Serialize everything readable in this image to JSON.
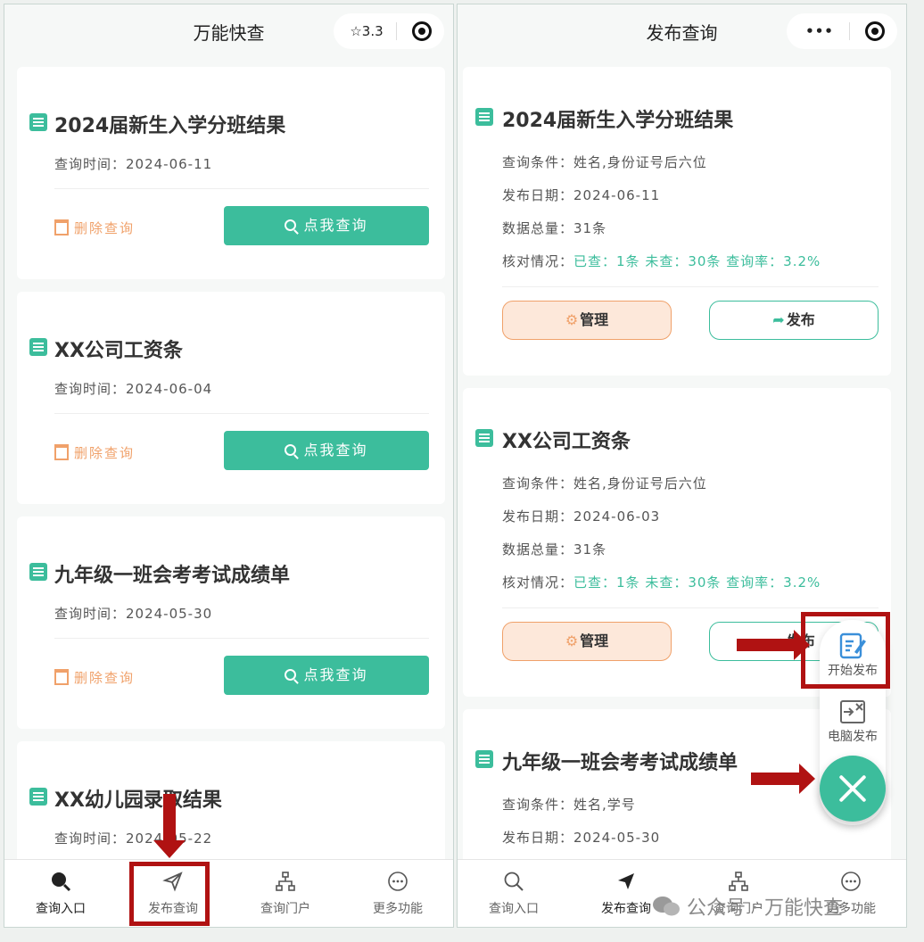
{
  "left": {
    "title": "万能快查",
    "rating": "☆3.3",
    "cards": [
      {
        "title": "2024届新生入学分班结果",
        "time": "查询时间：2024-06-11",
        "delete": "删除查询",
        "query": "点我查询"
      },
      {
        "title": "XX公司工资条",
        "time": "查询时间：2024-06-04",
        "delete": "删除查询",
        "query": "点我查询"
      },
      {
        "title": "九年级一班会考考试成绩单",
        "time": "查询时间：2024-05-30",
        "delete": "删除查询",
        "query": "点我查询"
      },
      {
        "title": "XX幼儿园录取结果",
        "time": "查询时间：2024-05-22"
      }
    ],
    "tabs": [
      "查询入口",
      "发布查询",
      "查询门户",
      "更多功能"
    ]
  },
  "right": {
    "title": "发布查询",
    "capsule_dots": "•••",
    "cards": [
      {
        "title": "2024届新生入学分班结果",
        "cond": "查询条件：姓名,身份证号后六位",
        "date": "发布日期：2024-06-11",
        "total": "数据总量：31条",
        "status_label": "核对情况：",
        "status": "已查：1条 未查：30条 查询率：3.2%",
        "manage": "管理",
        "publish": "发布"
      },
      {
        "title": "XX公司工资条",
        "cond": "查询条件：姓名,身份证号后六位",
        "date": "发布日期：2024-06-03",
        "total": "数据总量：31条",
        "status_label": "核对情况：",
        "status": "已查：1条 未查：30条 查询率：3.2%",
        "manage": "管理",
        "publish": "发布"
      },
      {
        "title": "九年级一班会考考试成绩单",
        "cond": "查询条件：姓名,学号",
        "date": "发布日期：2024-05-30"
      }
    ],
    "fab_items": [
      "开始发布",
      "电脑发布"
    ],
    "tabs": [
      "查询入口",
      "发布查询",
      "查询门户",
      "更多功能"
    ]
  },
  "watermark": "公众号 · 万能快查",
  "colors": {
    "accent": "#3cbd9c",
    "orange": "#f0a16a",
    "annotation_red": "#b01212"
  }
}
